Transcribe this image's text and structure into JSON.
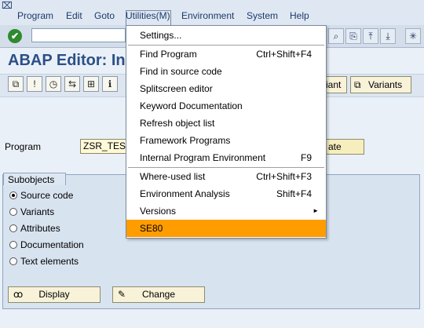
{
  "menubar": {
    "items": [
      "Program",
      "Edit",
      "Goto",
      "Utilities(M)",
      "Environment",
      "System",
      "Help"
    ]
  },
  "title": "ABAP Editor: Init",
  "app_toolbar": {
    "variant_label": "iant",
    "variants_label": "Variants"
  },
  "program": {
    "label": "Program",
    "value": "ZSR_TEST",
    "create_label": "ate"
  },
  "subobjects": {
    "title": "Subobjects",
    "options": [
      "Source code",
      "Variants",
      "Attributes",
      "Documentation",
      "Text elements"
    ],
    "selected": "Source code"
  },
  "buttons": {
    "display": "Display",
    "change": "Change"
  },
  "utilities_menu": {
    "items": [
      {
        "label": "Settings...",
        "shortcut": ""
      },
      {
        "label": "Find Program",
        "shortcut": "Ctrl+Shift+F4"
      },
      {
        "label": "Find in source code",
        "shortcut": ""
      },
      {
        "label": "Splitscreen editor",
        "shortcut": ""
      },
      {
        "label": "Keyword Documentation",
        "shortcut": ""
      },
      {
        "label": "Refresh object list",
        "shortcut": ""
      },
      {
        "label": "Framework Programs",
        "shortcut": ""
      },
      {
        "label": "Internal Program Environment",
        "shortcut": "F9"
      },
      {
        "label": "Where-used list",
        "shortcut": "Ctrl+Shift+F3"
      },
      {
        "label": "Environment Analysis",
        "shortcut": "Shift+F4"
      },
      {
        "label": "Versions",
        "shortcut": ""
      },
      {
        "label": "SE80",
        "shortcut": ""
      }
    ],
    "highlighted": "SE80"
  },
  "colors": {
    "highlight": "#ff9c00",
    "title": "#2c4f86",
    "menubar_text": "#1b3a6b"
  }
}
